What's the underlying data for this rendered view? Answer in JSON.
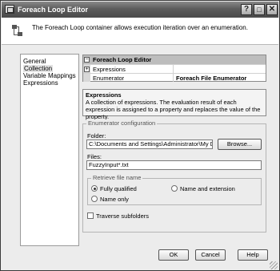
{
  "window": {
    "title": "Foreach Loop Editor"
  },
  "titlebar_buttons": {
    "help": "?",
    "maximize": "□",
    "close": "✕"
  },
  "header": {
    "description": "The Foreach Loop container allows execution iteration over an enumeration."
  },
  "nav": {
    "items": [
      {
        "label": "General"
      },
      {
        "label": "Collection"
      },
      {
        "label": "Variable Mappings"
      },
      {
        "label": "Expressions"
      }
    ]
  },
  "property_grid": {
    "title": "Foreach Loop Editor",
    "rows": [
      {
        "name": "Expressions",
        "value": ""
      },
      {
        "name": "Enumerator",
        "value": "Foreach File Enumerator"
      }
    ]
  },
  "description": {
    "title": "Expressions",
    "text": "A collection of expressions. The evaluation result of each expression is assigned to a property and replaces the value of the property."
  },
  "enumerator_config": {
    "title": "Enumerator configuration",
    "folder_label": "Folder:",
    "folder_value": "C:\\Documents and Settings\\Administrator\\My Docume",
    "browse_label": "Browse...",
    "files_label": "Files:",
    "files_value": "FuzzyInput*.txt",
    "retrieve": {
      "title": "Retrieve file name",
      "options": [
        {
          "label": "Fully qualified"
        },
        {
          "label": "Name and extension"
        },
        {
          "label": "Name only"
        }
      ]
    },
    "traverse_label": "Traverse subfolders"
  },
  "buttons": {
    "ok": "OK",
    "cancel": "Cancel",
    "help": "Help"
  }
}
